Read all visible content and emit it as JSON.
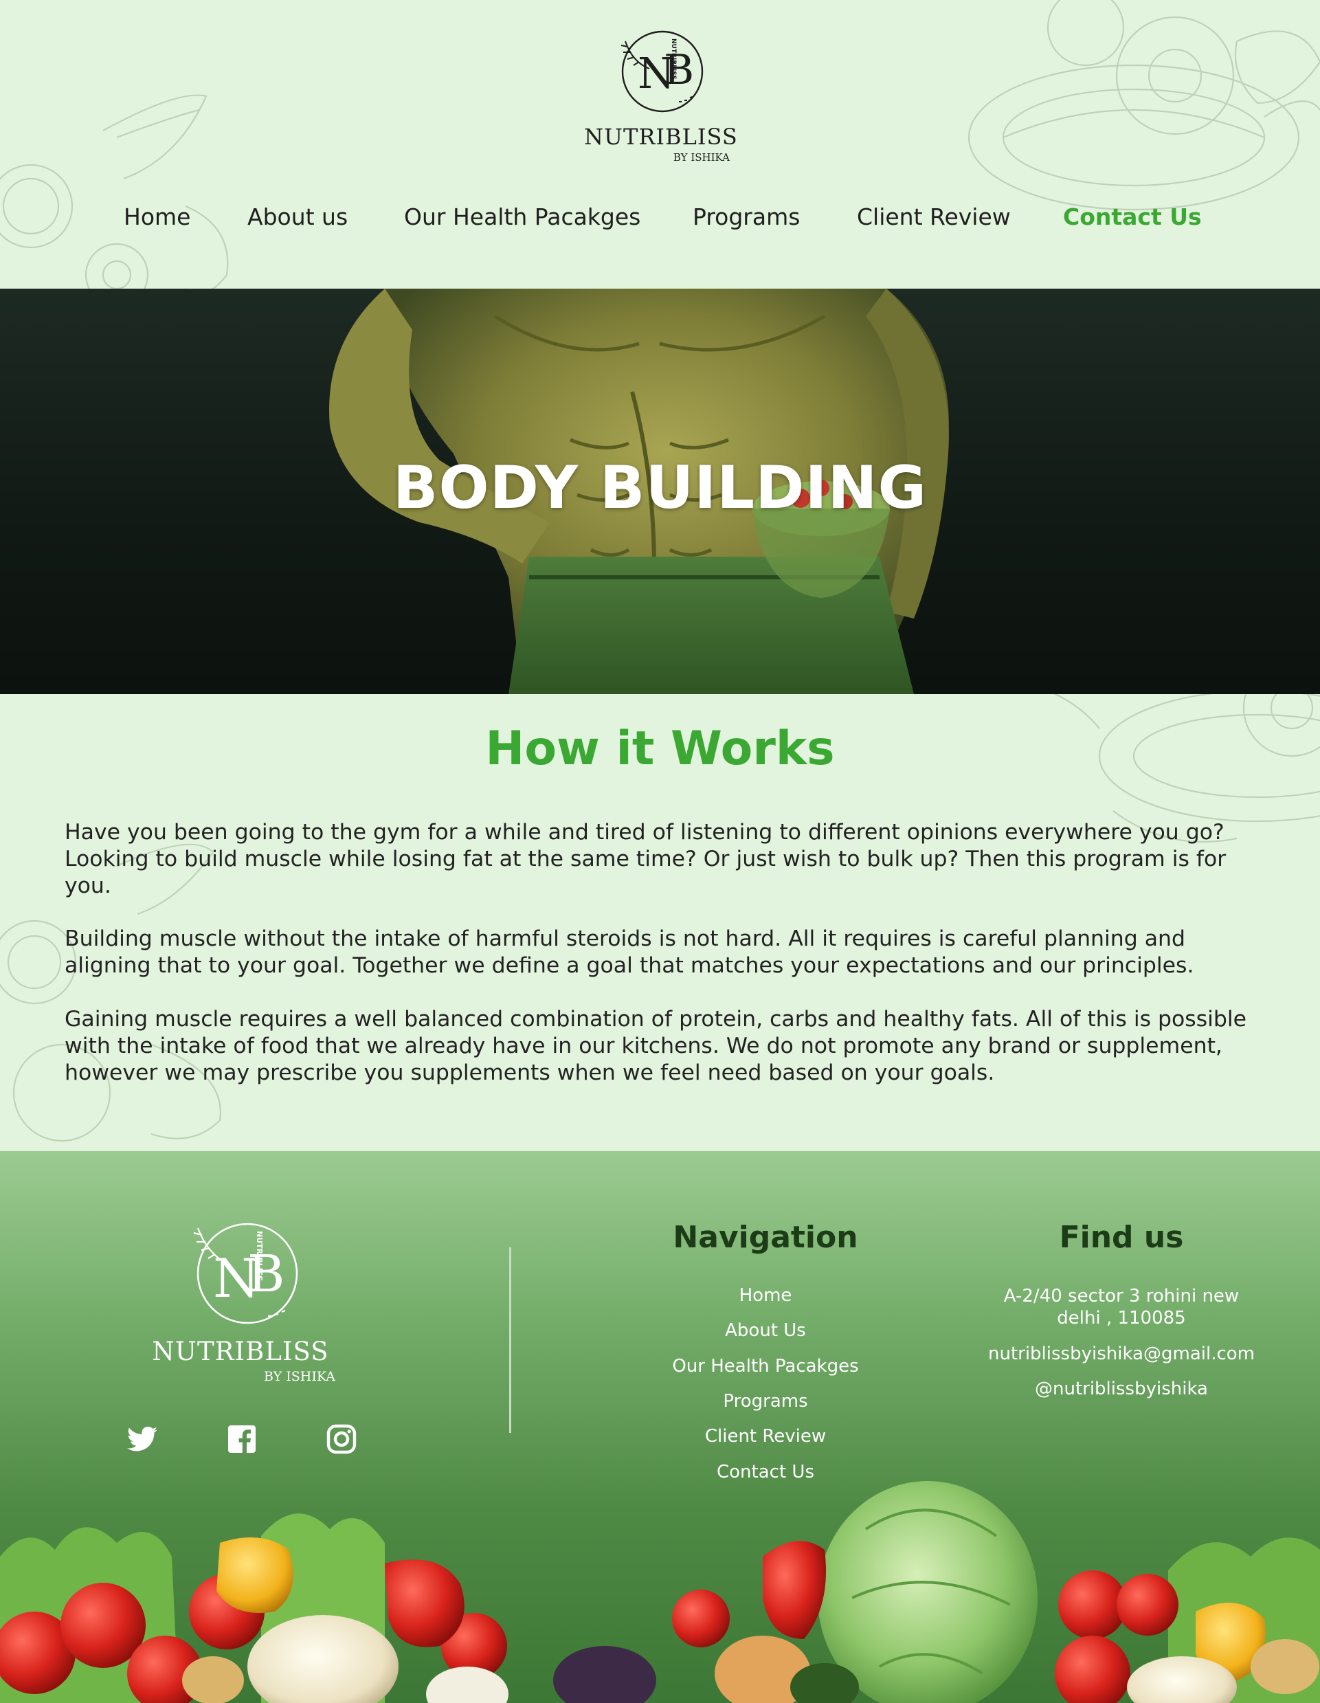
{
  "brand": {
    "name": "NUTRIBLISS",
    "sub": "BY ISHIKA",
    "monogram": "NB",
    "logo_text": "NUTRIBLISS"
  },
  "nav": {
    "items": [
      {
        "label": "Home",
        "active": false
      },
      {
        "label": "About us",
        "active": false
      },
      {
        "label": "Our Health Pacakges",
        "active": false
      },
      {
        "label": "Programs",
        "active": false
      },
      {
        "label": "Client Review",
        "active": false
      },
      {
        "label": "Contact Us",
        "active": true
      }
    ]
  },
  "hero": {
    "title": "BODY BUILDING"
  },
  "how": {
    "title": "How it Works",
    "paragraphs": [
      "Have you been going to the gym for a while and tired of listening to different opinions everywhere you go? Looking to build muscle while losing fat at the same time? Or just wish to bulk up? Then this program is for you.",
      "Building muscle without the intake of harmful steroids is not hard. All it requires is careful planning and aligning that to your goal. Together we define a goal that matches your expectations and our principles.",
      "Gaining muscle requires a well balanced combination of protein, carbs and healthy fats. All of this is possible with the intake of food that we already have in our kitchens. We do not promote any brand or supplement, however we may prescribe you supplements when we feel need based on your goals."
    ]
  },
  "footer": {
    "social": [
      "twitter-icon",
      "facebook-icon",
      "instagram-icon"
    ],
    "navigation": {
      "title": "Navigation",
      "links": [
        "Home",
        "About Us",
        "Our Health Pacakges",
        "Programs",
        "Client Review",
        "Contact Us"
      ]
    },
    "find_us": {
      "title": "Find us",
      "address": "A-2/40 sector 3 rohini new delhi , 110085",
      "email": "nutriblissbyishika@gmail.com",
      "handle": "@nutriblissbyishika"
    }
  },
  "colors": {
    "accent": "#3aa832",
    "background": "#e3f4de",
    "footer_dark": "#3d7735",
    "heading_dark": "#1c3b17"
  }
}
